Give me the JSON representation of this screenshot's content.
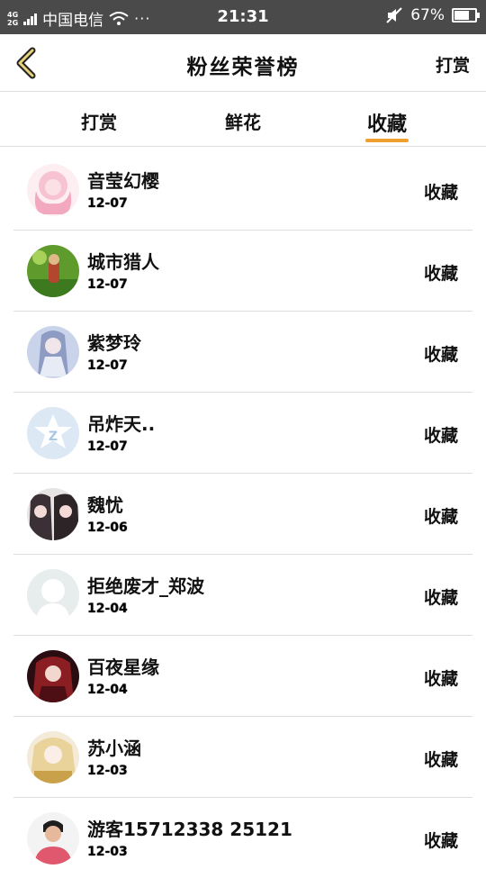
{
  "status_bar": {
    "network": "4G\n2G",
    "carrier": "中国电信",
    "dots": "···",
    "time": "21:31",
    "battery_percent": "67%",
    "battery_level": 0.67
  },
  "header": {
    "title": "粉丝荣誉榜",
    "right_action": "打赏"
  },
  "tabs": [
    {
      "label": "打赏"
    },
    {
      "label": "鲜花"
    },
    {
      "label": "收藏",
      "active": true
    }
  ],
  "accent_color": "#f0a030",
  "list": [
    {
      "name": "音莹幻樱",
      "date": "12-07",
      "action": "收藏",
      "avatar": "pink-anime-girl"
    },
    {
      "name": "城市猎人",
      "date": "12-07",
      "action": "收藏",
      "avatar": "game-character-green"
    },
    {
      "name": "紫梦玲",
      "date": "12-07",
      "action": "收藏",
      "avatar": "anime-blue-hair"
    },
    {
      "name": "吊炸天..",
      "date": "12-07",
      "action": "收藏",
      "avatar": "default-star-logo"
    },
    {
      "name": "魏忧",
      "date": "12-06",
      "action": "收藏",
      "avatar": "two-anime-characters"
    },
    {
      "name": "拒绝废才_郑波",
      "date": "12-04",
      "action": "收藏",
      "avatar": "default-silhouette"
    },
    {
      "name": "百夜星缘",
      "date": "12-04",
      "action": "收藏",
      "avatar": "red-anime-girl"
    },
    {
      "name": "苏小涵",
      "date": "12-03",
      "action": "收藏",
      "avatar": "blonde-anime-girl"
    },
    {
      "name": "游客15712338 25121",
      "date": "12-03",
      "action": "收藏",
      "avatar": "photo-person"
    }
  ]
}
